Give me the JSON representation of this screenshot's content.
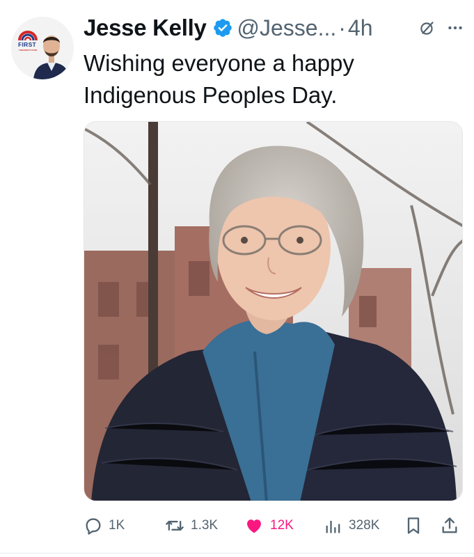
{
  "author": {
    "name": "Jesse Kelly",
    "handle": "@Jesse...",
    "separator": "·",
    "time": "4h",
    "avatar_badge_text": "FIRST",
    "avatar_badge_url": "THEFIRSTTV.COM"
  },
  "tweet": {
    "text": "Wishing everyone a happy Indigenous Peoples Day."
  },
  "icons": {
    "verified": "verified-badge-icon",
    "grok": "grok-icon",
    "more": "more-icon",
    "reply": "reply-icon",
    "retweet": "retweet-icon",
    "like": "heart-icon",
    "views": "views-icon",
    "bookmark": "bookmark-icon",
    "share": "share-icon"
  },
  "actions": {
    "replies": "1K",
    "reposts": "1.3K",
    "likes": "12K",
    "views": "328K"
  },
  "colors": {
    "verified": "#1d9bf0",
    "like": "#f91880",
    "muted": "#536471"
  }
}
